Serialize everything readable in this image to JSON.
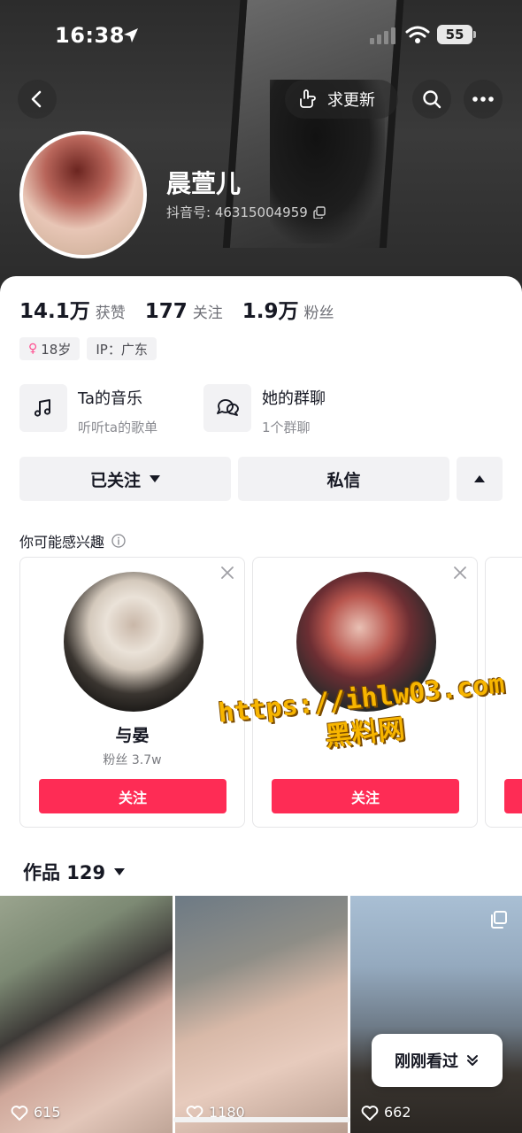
{
  "status_bar": {
    "time": "16:38",
    "battery": "55"
  },
  "header": {
    "update_label": "求更新",
    "user_name": "晨萱儿",
    "user_id": "抖音号: 46315004959"
  },
  "stats": [
    {
      "num": "14.1万",
      "label": "获赞"
    },
    {
      "num": "177",
      "label": "关注"
    },
    {
      "num": "1.9万",
      "label": "粉丝"
    }
  ],
  "tags": {
    "age": "18岁",
    "ip": "IP：广东"
  },
  "features": {
    "music": {
      "title": "Ta的音乐",
      "sub": "听听ta的歌单"
    },
    "group": {
      "title": "她的群聊",
      "sub": "1个群聊"
    }
  },
  "actions": {
    "followed": "已关注",
    "message": "私信"
  },
  "suggestions": {
    "title": "你可能感兴趣",
    "items": [
      {
        "name": "与晏",
        "fans": "粉丝 3.7w",
        "follow": "关注"
      },
      {
        "name": "",
        "fans": "",
        "follow": "关注"
      }
    ]
  },
  "watermark": {
    "url": "https://ihlw03.com",
    "name": "黑料网"
  },
  "works": {
    "title": "作品 129",
    "tiles": [
      {
        "likes": "615"
      },
      {
        "likes": "1180"
      },
      {
        "likes": "662"
      }
    ],
    "recent_label": "刚刚看过"
  },
  "colors": {
    "accent": "#fe2c55",
    "header_bg": "#2c2c2c",
    "watermark": "#f7b500"
  }
}
